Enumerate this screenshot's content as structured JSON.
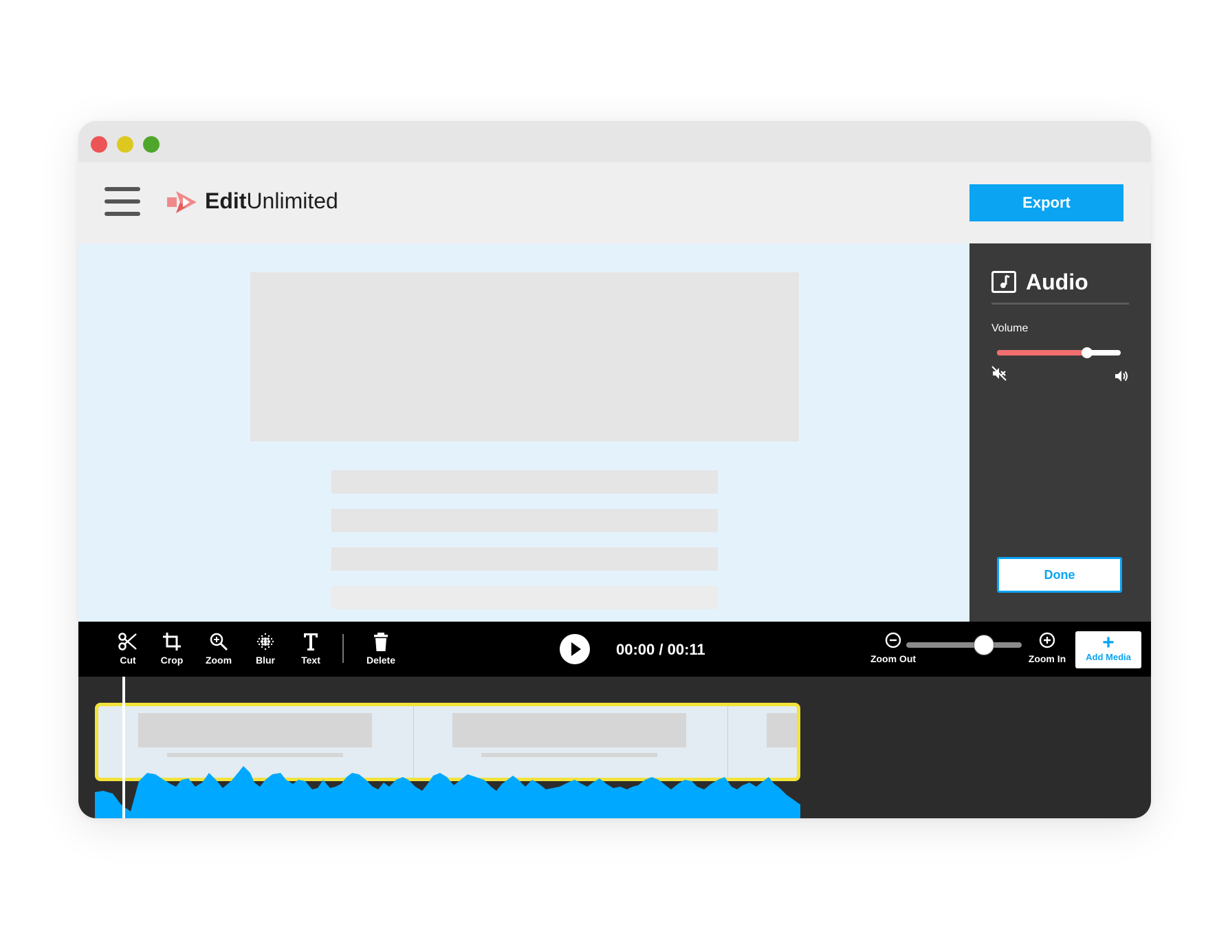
{
  "app": {
    "brand_bold": "Edit",
    "brand_light": "Unlimited",
    "export_label": "Export",
    "accent_color": "#0aa4f2"
  },
  "window_controls": [
    "close",
    "minimize",
    "maximize"
  ],
  "audio_panel": {
    "title": "Audio",
    "icon": "music-note-icon",
    "volume_label": "Volume",
    "volume_level": 0.73,
    "volume_color": "#f06f6e",
    "done_label": "Done"
  },
  "toolbar": {
    "tools": [
      {
        "label": "Cut",
        "icon": "scissors-icon"
      },
      {
        "label": "Crop",
        "icon": "crop-icon"
      },
      {
        "label": "Zoom",
        "icon": "magnifier-icon"
      },
      {
        "label": "Blur",
        "icon": "blur-icon"
      },
      {
        "label": "Text",
        "icon": "text-icon"
      },
      {
        "label": "Delete",
        "icon": "trash-icon"
      }
    ],
    "timecode": "00:00 / 00:11",
    "zoom_out_label": "Zoom Out",
    "zoom_in_label": "Zoom In",
    "zoom_level": 0.67,
    "add_media_plus": "+",
    "add_media_label": "Add Media"
  },
  "timeline": {
    "clip_border_color": "#f2e23a",
    "waveform_color": "#00a8ff",
    "playhead_time": "00:00"
  }
}
